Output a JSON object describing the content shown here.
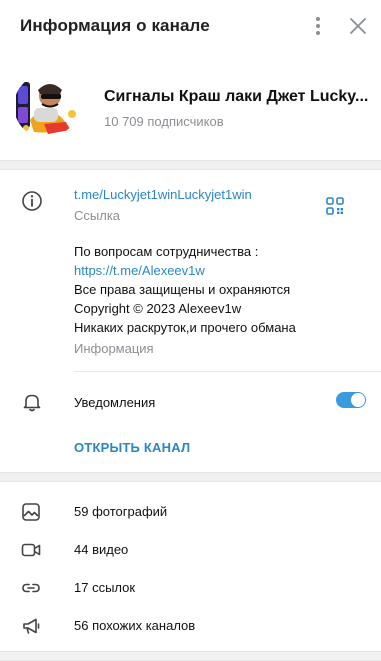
{
  "header": {
    "title": "Информация о канале"
  },
  "channel": {
    "name": "Сигналы Краш лаки Джет Lucky...",
    "subscribers": "10 709 подписчиков"
  },
  "info": {
    "link": "t.me/Luckyjet1winLuckyjet1win",
    "link_caption": "Ссылка",
    "description_lines": [
      "По вопросам сотрудничества :",
      "https://t.me/Alexeev1w",
      "Все права защищены и охраняются",
      "Copyright © 2023 Alexeev1w",
      "Никаких раскруток,и прочего обмана"
    ],
    "description_caption": "Информация"
  },
  "notifications": {
    "label": "Уведомления",
    "enabled": true
  },
  "open_channel_label": "ОТКРЫТЬ КАНАЛ",
  "media": [
    {
      "icon": "photo-icon",
      "label": "59 фотографий"
    },
    {
      "icon": "video-icon",
      "label": "44 видео"
    },
    {
      "icon": "link-icon",
      "label": "17 ссылок"
    },
    {
      "icon": "megaphone-icon",
      "label": "56 похожих каналов"
    }
  ],
  "colors": {
    "accent": "#2a86c7",
    "toggle_on": "#3a9ae0",
    "muted_text": "#8b8f94"
  }
}
